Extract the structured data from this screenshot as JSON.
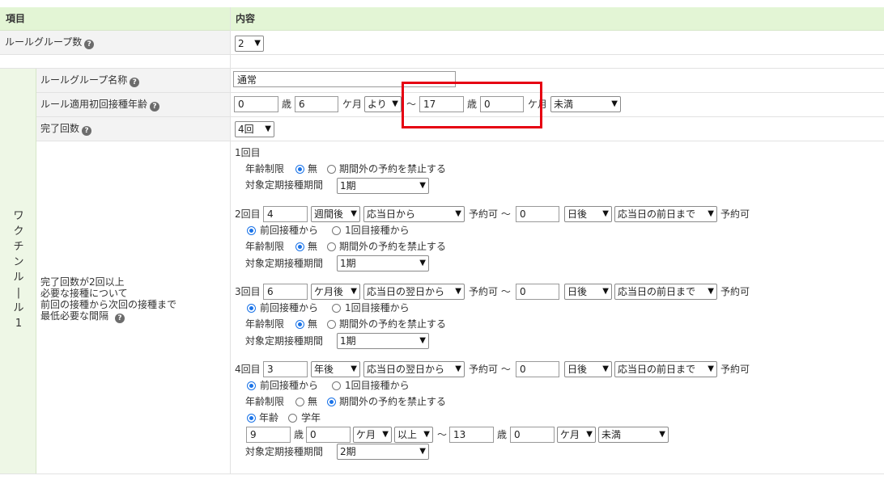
{
  "header": {
    "col_item": "項目",
    "col_content": "内容"
  },
  "rule_group_count": {
    "label": "ルールグループ数",
    "value": "2"
  },
  "group": {
    "side_label": [
      "ワ",
      "ク",
      "チ",
      "ン",
      "ル",
      "|",
      "ル",
      "1"
    ],
    "name_label": "ルールグループ名称",
    "name_value": "通常",
    "age_label": "ルール適用初回接種年齢",
    "age_from_years": "0",
    "age_from_months": "6",
    "age_from_cond": "より",
    "age_to_years": "17",
    "age_to_months": "0",
    "age_to_cond": "未満",
    "unit_years": "歳",
    "unit_months": "ケ月",
    "tilde": "～",
    "doses_label": "完了回数",
    "doses_value": "4回",
    "interval_label": [
      "完了回数が2回以上",
      "必要な接種について",
      "前回の接種から次回の接種まで",
      "最低必要な間隔"
    ]
  },
  "common": {
    "age_limit": "年齢制限",
    "none": "無",
    "forbid": "期間外の予約を禁止する",
    "period_label": "対象定期接種期間",
    "reservable": "予約可",
    "from_prev": "前回接種から",
    "from_first": "1回目接種から",
    "by_age": "年齢",
    "by_grade": "学年",
    "plus": "以上"
  },
  "dose1": {
    "label": "1回目",
    "period": "1期"
  },
  "dose2": {
    "label": "2回目",
    "value": "4",
    "unit": "週間後",
    "from": "応当日から",
    "value2": "0",
    "unit2": "日後",
    "until": "応当日の前日まで",
    "period": "1期"
  },
  "dose3": {
    "label": "3回目",
    "value": "6",
    "unit": "ケ月後",
    "from": "応当日の翌日から",
    "value2": "0",
    "unit2": "日後",
    "until": "応当日の前日まで",
    "period": "1期"
  },
  "dose4": {
    "label": "4回目",
    "value": "3",
    "unit": "年後",
    "from": "応当日の翌日から",
    "value2": "0",
    "unit2": "日後",
    "until": "応当日の前日まで",
    "age_from_years": "9",
    "age_from_months": "0",
    "age_to_years": "13",
    "age_to_months": "0",
    "age_to_cond": "未満",
    "period": "2期"
  },
  "colors": {
    "header_bg": "#e3f5d5",
    "highlight": "#e60012",
    "radio": "#1a73e8"
  }
}
